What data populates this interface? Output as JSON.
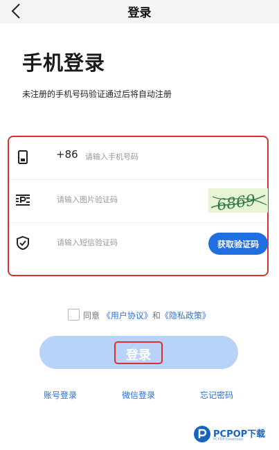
{
  "header": {
    "title": "登录",
    "back_icon": "chevron-left-icon"
  },
  "page": {
    "title": "手机登录",
    "subtitle": "未注册的手机号码验证通过后将自动注册"
  },
  "form": {
    "phone": {
      "icon": "phone-icon",
      "prefix": "+86",
      "placeholder": "请输入手机号码",
      "value": ""
    },
    "captcha": {
      "icon": "captcha-icon",
      "placeholder": "请输入图片验证码",
      "value": "",
      "image_text": "6869"
    },
    "sms": {
      "icon": "shield-check-icon",
      "placeholder": "请输入短信验证码",
      "value": "",
      "button_label": "获取验证码"
    }
  },
  "agreement": {
    "prefix": "同意",
    "user_agreement": "《用户协议》",
    "conjunction": "和",
    "privacy_policy": "《隐私政策》"
  },
  "login_button": {
    "label": "登录"
  },
  "links": {
    "account_login": "账号登录",
    "wechat_login": "微信登录",
    "forgot_password": "忘记密码"
  },
  "watermark": {
    "text": "PCPOP下载",
    "sub": "PCPOP Download"
  },
  "colors": {
    "accent": "#1f6fe0",
    "login_button": "#b8d3f7",
    "highlight": "#d9302b",
    "link": "#2c6fd0"
  }
}
